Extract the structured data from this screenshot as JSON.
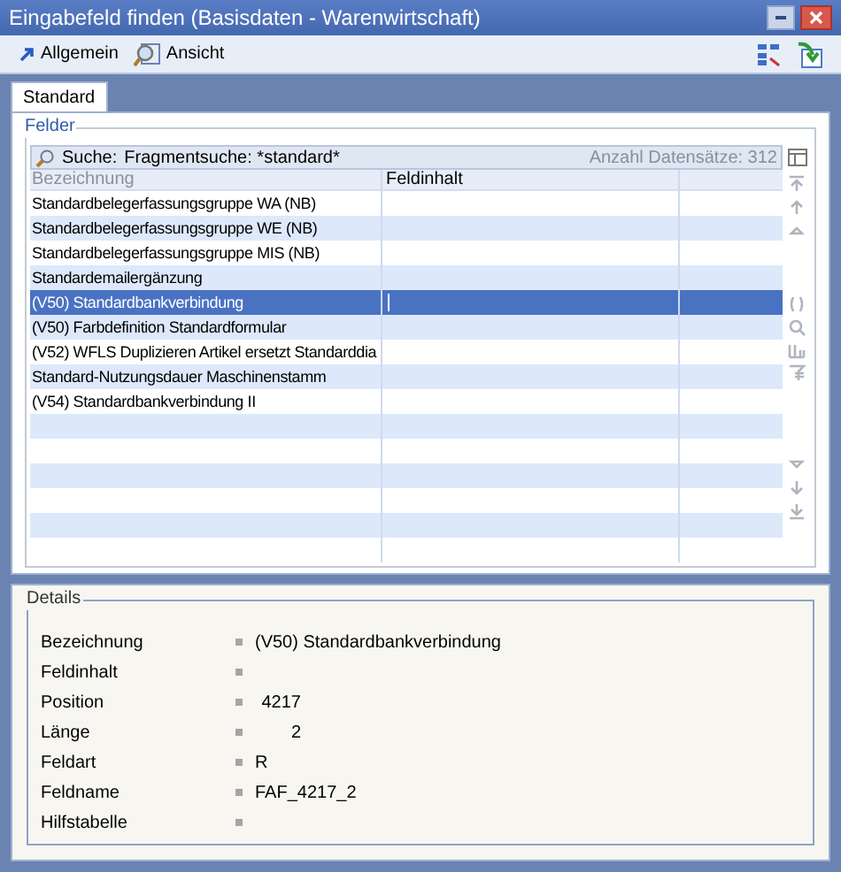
{
  "window": {
    "title": "Eingabefeld finden (Basisdaten - Warenwirtschaft)"
  },
  "toolbar": [
    {
      "label": "Allgemein",
      "kind": "arrow"
    },
    {
      "label": "Ansicht",
      "kind": "view"
    }
  ],
  "tabs": [
    {
      "label": "Standard",
      "selected": true
    }
  ],
  "fields_group": {
    "title": "Felder",
    "search": {
      "label": "Suche:",
      "value": "Fragmentsuche: *standard*",
      "count": "Anzahl Datensätze: 312"
    },
    "columns": [
      "Bezeichnung",
      "Feldinhalt"
    ],
    "rows": [
      {
        "name": "Standardbelegerfassungsgruppe WA (NB)",
        "selected": false
      },
      {
        "name": "Standardbelegerfassungsgruppe WE (NB)",
        "selected": false
      },
      {
        "name": "Standardbelegerfassungsgruppe MIS (NB)",
        "selected": false
      },
      {
        "name": "Standardemailergänzung",
        "selected": false
      },
      {
        "name": "(V50) Standardbankverbindung",
        "selected": true
      },
      {
        "name": "(V50) Farbdefinition Standardformular",
        "selected": false
      },
      {
        "name": "(V52) WFLS Duplizieren Artikel ersetzt Standarddia",
        "selected": false
      },
      {
        "name": "Standard-Nutzungsdauer Maschinenstamm",
        "selected": false
      },
      {
        "name": "(V54) Standardbankverbindung II",
        "selected": false
      }
    ]
  },
  "details": {
    "title": "Details",
    "fields": [
      {
        "label": "Bezeichnung",
        "value": "(V50) Standardbankverbindung"
      },
      {
        "label": "Feldinhalt"
      },
      {
        "label": "Position",
        "value": "4217",
        "kind": "number"
      },
      {
        "label": "Länge",
        "value": "2",
        "kind": "number"
      },
      {
        "label": "Feldart",
        "value": "R"
      },
      {
        "label": "Feldname",
        "value": "FAF_4217_2"
      },
      {
        "label": "Hilfstabelle"
      }
    ]
  }
}
